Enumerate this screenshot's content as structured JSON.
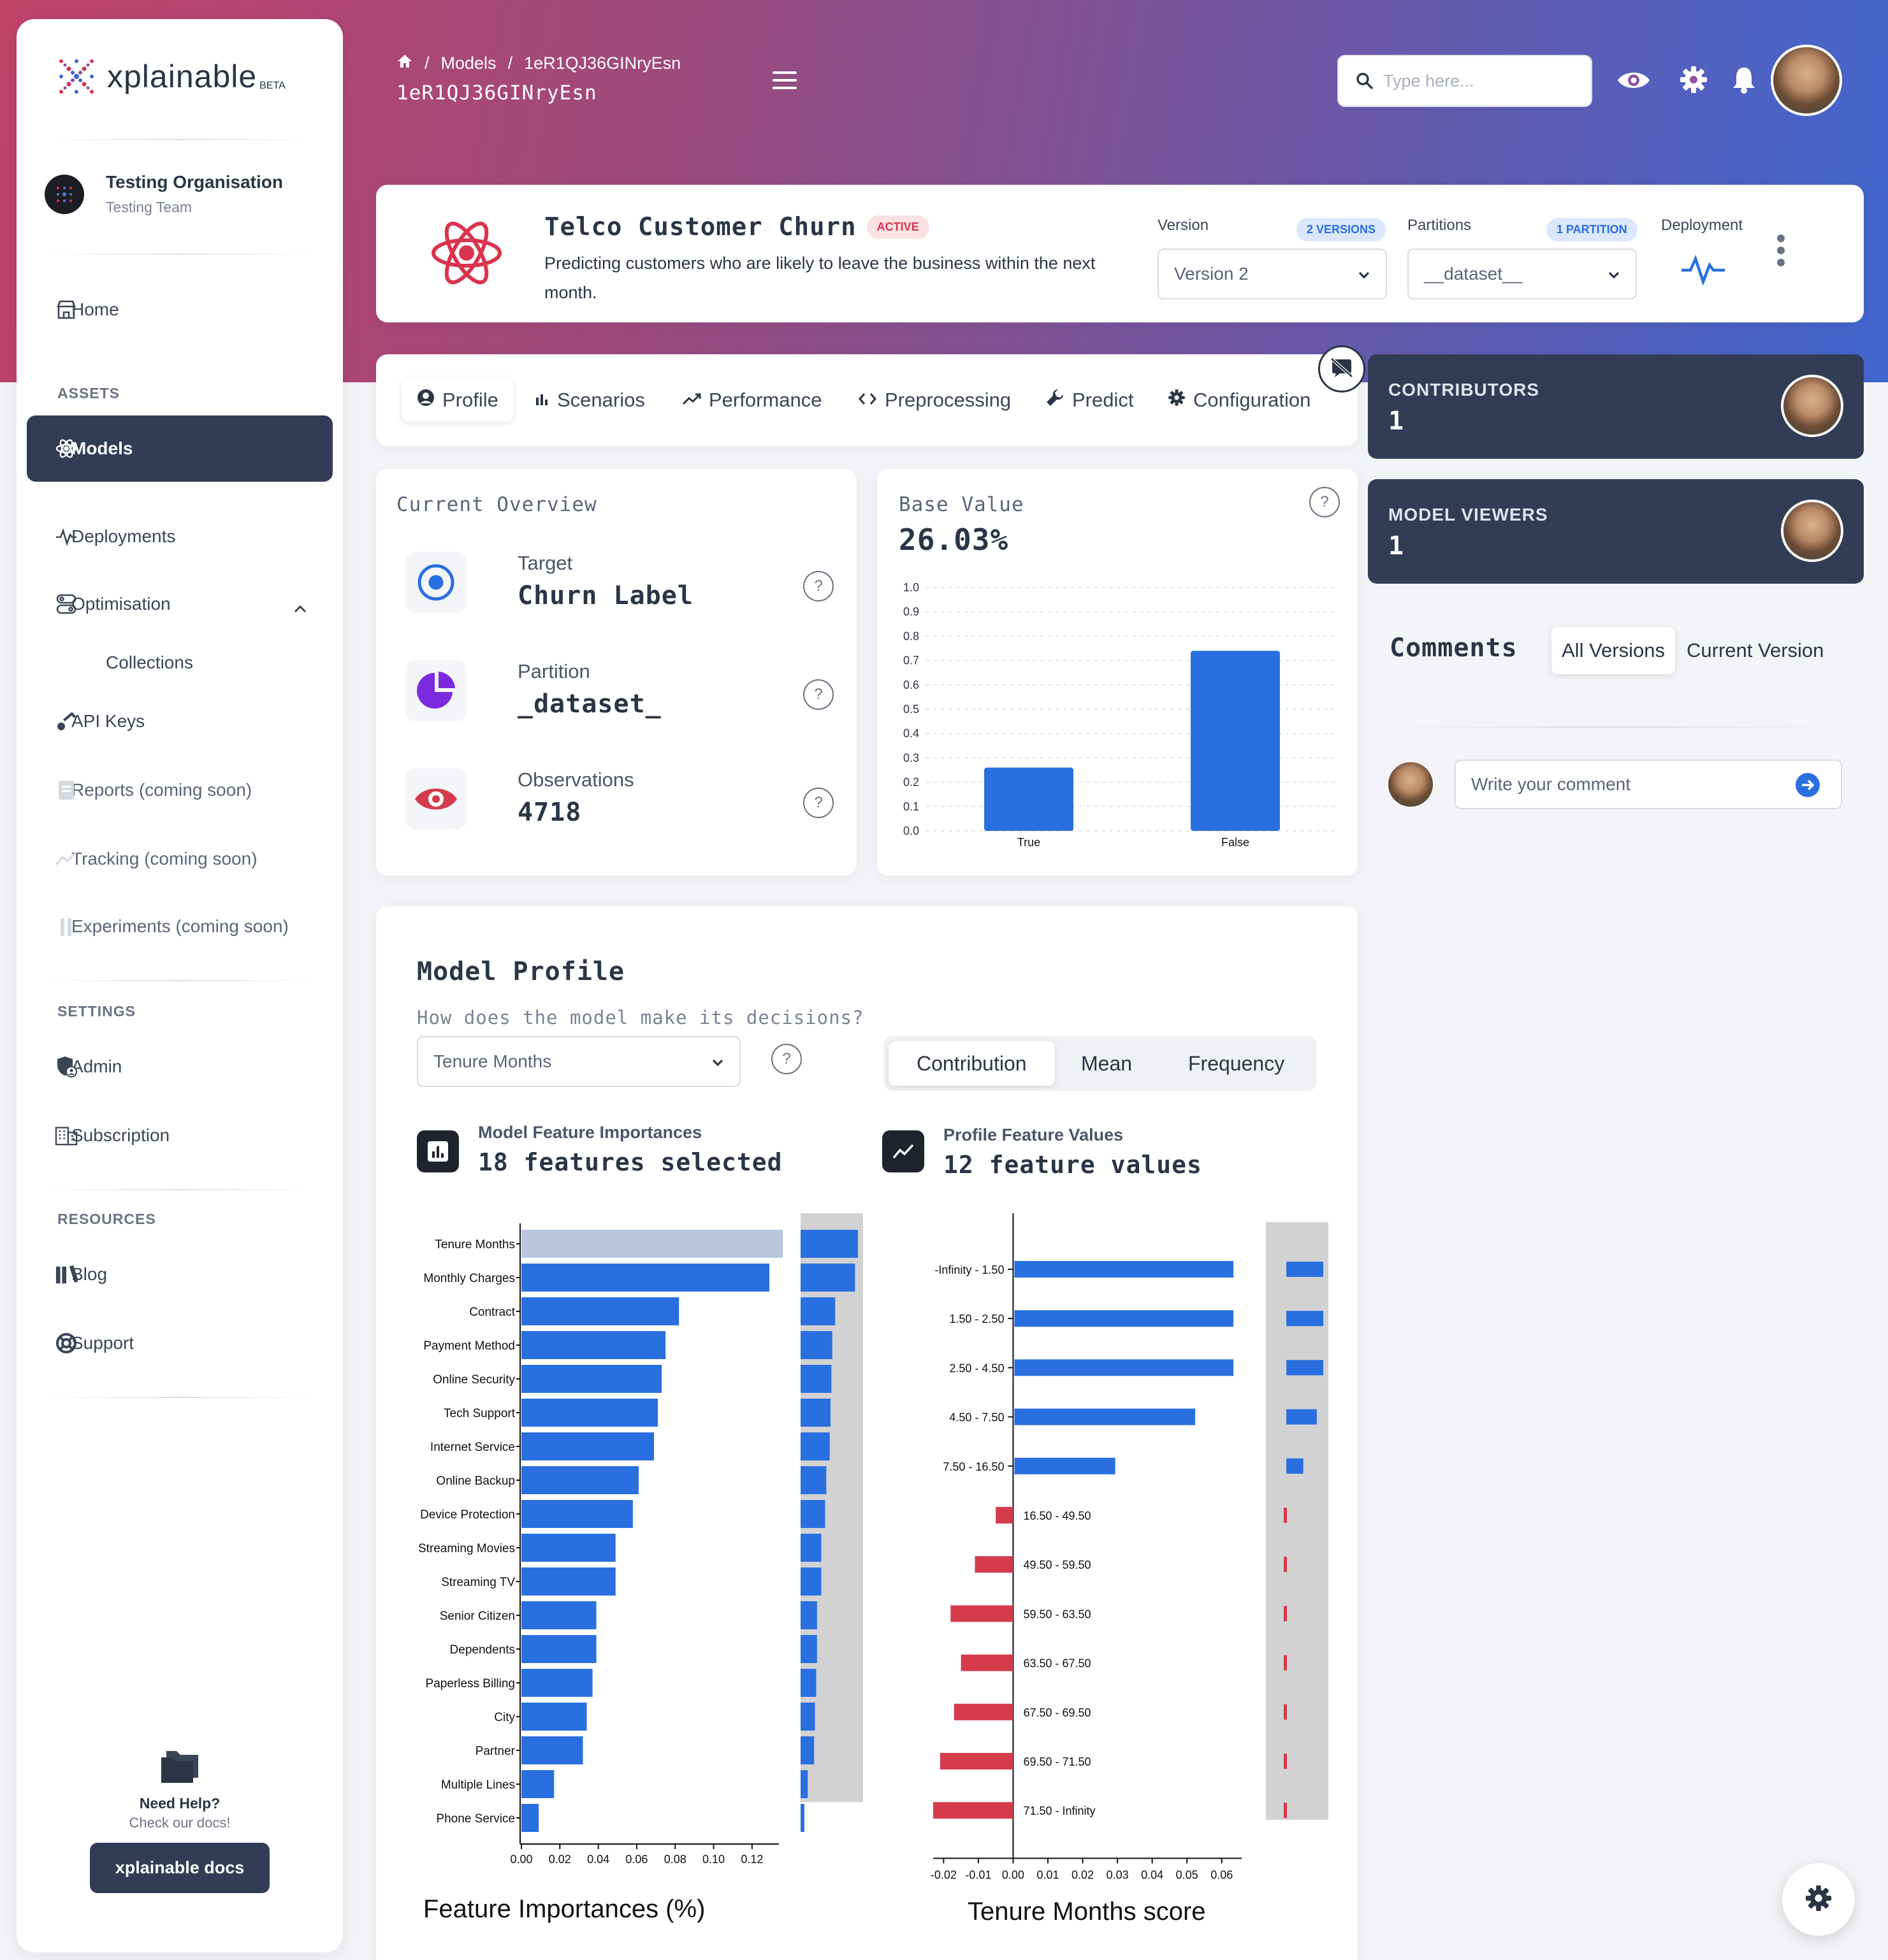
{
  "brand": {
    "name": "xplainable",
    "badge": "BETA"
  },
  "organisation": {
    "name": "Testing Organisation",
    "team": "Testing Team"
  },
  "sidebar": {
    "home": "Home",
    "assets_label": "ASSETS",
    "assets": [
      {
        "label": "Models",
        "icon": "atom-icon",
        "active": true
      },
      {
        "label": "Deployments",
        "icon": "pulse-icon"
      },
      {
        "label": "Optimisation",
        "icon": "optimisation-icon"
      },
      {
        "label": "Collections",
        "icon": ""
      },
      {
        "label": "API Keys",
        "icon": "key-icon"
      },
      {
        "label": "Reports (coming soon)",
        "icon": "report-icon"
      },
      {
        "label": "Tracking (coming soon)",
        "icon": "tracking-icon"
      },
      {
        "label": "Experiments (coming soon)",
        "icon": "experiments-icon"
      }
    ],
    "settings_label": "SETTINGS",
    "settings": [
      {
        "label": "Admin",
        "icon": "admin-icon"
      },
      {
        "label": "Subscription",
        "icon": "building-icon"
      }
    ],
    "resources_label": "RESOURCES",
    "resources": [
      {
        "label": "Blog",
        "icon": "books-icon"
      },
      {
        "label": "Support",
        "icon": "lifebuoy-icon"
      }
    ],
    "help": {
      "title": "Need Help?",
      "subtitle": "Check our docs!",
      "button": "xplainable docs"
    }
  },
  "topbar": {
    "breadcrumb": [
      "Models",
      "1eR1QJ36GINryEsn"
    ],
    "page_title": "1eR1QJ36GINryEsn",
    "search_placeholder": "Type here..."
  },
  "model": {
    "name": "Telco Customer Churn",
    "status": "ACTIVE",
    "description": "Predicting customers who are likely to leave the business within the next month.",
    "version_label": "Version",
    "versions_badge": "2 VERSIONS",
    "version_value": "Version 2",
    "partitions_label": "Partitions",
    "partitions_badge": "1 PARTITION",
    "partition_value": "__dataset__",
    "deployment_label": "Deployment"
  },
  "tabs": [
    "Profile",
    "Scenarios",
    "Performance",
    "Preprocessing",
    "Predict",
    "Configuration"
  ],
  "overview": {
    "title": "Current Overview",
    "target_label": "Target",
    "target_value": "Churn Label",
    "partition_label": "Partition",
    "partition_value": "_dataset_",
    "observations_label": "Observations",
    "observations_value": "4718"
  },
  "base_value": {
    "title": "Base Value",
    "value": "26.03%"
  },
  "contributors": {
    "label": "CONTRIBUTORS",
    "count": "1"
  },
  "viewers": {
    "label": "MODEL VIEWERS",
    "count": "1"
  },
  "comments": {
    "title": "Comments",
    "filters": [
      "All Versions",
      "Current Version"
    ],
    "placeholder": "Write your comment"
  },
  "model_profile": {
    "title": "Model Profile",
    "subtitle": "How does the model make its decisions?",
    "feature_select": "Tenure Months",
    "modes": [
      "Contribution",
      "Mean",
      "Frequency"
    ],
    "importances_label": "Model Feature Importances",
    "importances_value": "18 features selected",
    "profile_label": "Profile Feature Values",
    "profile_value": "12 feature values"
  },
  "colors": {
    "accent": "#2a6fdf",
    "dark": "#323c55",
    "negative": "#d43c4e",
    "brand": "#d9344f"
  },
  "chart_data": [
    {
      "type": "bar",
      "title": "",
      "categories": [
        "True",
        "False"
      ],
      "values": [
        0.26,
        0.74
      ],
      "ylim": [
        0,
        1.0
      ],
      "yticks": [
        "0.0",
        "0.1",
        "0.2",
        "0.3",
        "0.4",
        "0.5",
        "0.6",
        "0.7",
        "0.8",
        "0.9",
        "1.0"
      ],
      "grid": true
    },
    {
      "type": "bar",
      "orientation": "horizontal",
      "xlabel": "Feature Importances (%)",
      "categories": [
        "Tenure Months",
        "Monthly Charges",
        "Contract",
        "Payment Method",
        "Online Security",
        "Tech Support",
        "Internet Service",
        "Online Backup",
        "Device Protection",
        "Streaming Movies",
        "Streaming TV",
        "Senior Citizen",
        "Dependents",
        "Paperless Billing",
        "City",
        "Partner",
        "Multiple Lines",
        "Phone Service"
      ],
      "values": [
        0.136,
        0.129,
        0.082,
        0.075,
        0.073,
        0.071,
        0.069,
        0.061,
        0.058,
        0.049,
        0.049,
        0.039,
        0.039,
        0.037,
        0.034,
        0.032,
        0.017,
        0.009
      ],
      "highlight": "Tenure Months",
      "xlim": [
        0,
        0.13
      ],
      "xticks": [
        "0.00",
        "0.02",
        "0.04",
        "0.06",
        "0.08",
        "0.10",
        "0.12"
      ]
    },
    {
      "type": "bar",
      "orientation": "horizontal",
      "xlabel": "Tenure Months score",
      "categories": [
        "-Infinity - 1.50",
        "1.50 - 2.50",
        "2.50 - 4.50",
        "4.50 - 7.50",
        "7.50 - 16.50",
        "16.50 - 49.50",
        "49.50 - 59.50",
        "59.50 - 63.50",
        "63.50 - 67.50",
        "67.50 - 69.50",
        "69.50 - 71.50",
        "71.50 - Infinity"
      ],
      "values": [
        0.063,
        0.063,
        0.063,
        0.052,
        0.029,
        -0.005,
        -0.011,
        -0.018,
        -0.015,
        -0.017,
        -0.021,
        -0.023
      ],
      "xlim": [
        -0.023,
        0.065
      ],
      "xticks": [
        "-0.02",
        "-0.01",
        "0.00",
        "0.01",
        "0.02",
        "0.03",
        "0.04",
        "0.05",
        "0.06"
      ]
    }
  ]
}
